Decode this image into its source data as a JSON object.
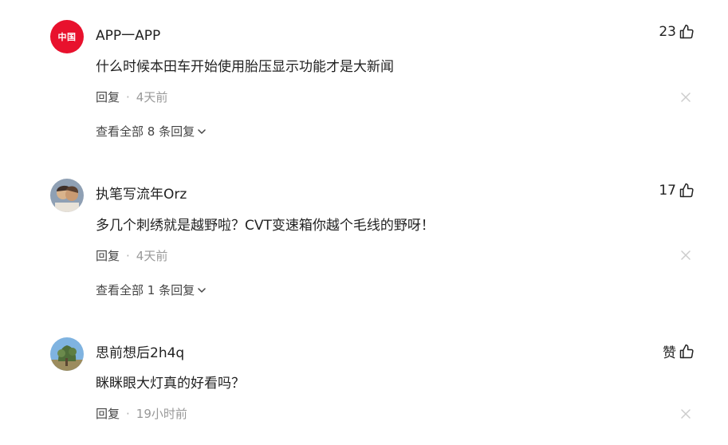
{
  "comments": [
    {
      "avatar_text": "中国",
      "username": "APP一APP",
      "content": "什么时候本田车开始使用胎压显示功能才是大新闻",
      "likes": "23",
      "reply_label": "回复",
      "separator": "·",
      "time": "4天前",
      "view_replies": "查看全部 8 条回复"
    },
    {
      "username": "执笔写流年Orz",
      "content": "多几个刺绣就是越野啦？CVT变速箱你越个毛线的野呀！",
      "likes": "17",
      "reply_label": "回复",
      "separator": "·",
      "time": "4天前",
      "view_replies": "查看全部 1 条回复"
    },
    {
      "username": "思前想后2h4q",
      "content": "眯眯眼大灯真的好看吗？",
      "likes": "赞",
      "reply_label": "回复",
      "separator": "·",
      "time": "19小时前"
    }
  ],
  "icons": {
    "like": "thumbs-up-icon",
    "close": "close-icon",
    "expand": "chevron-down-icon"
  },
  "colors": {
    "avatar_red": "#e8112d",
    "text": "#222222",
    "muted": "#999999",
    "icon_gray": "#cccccc"
  }
}
